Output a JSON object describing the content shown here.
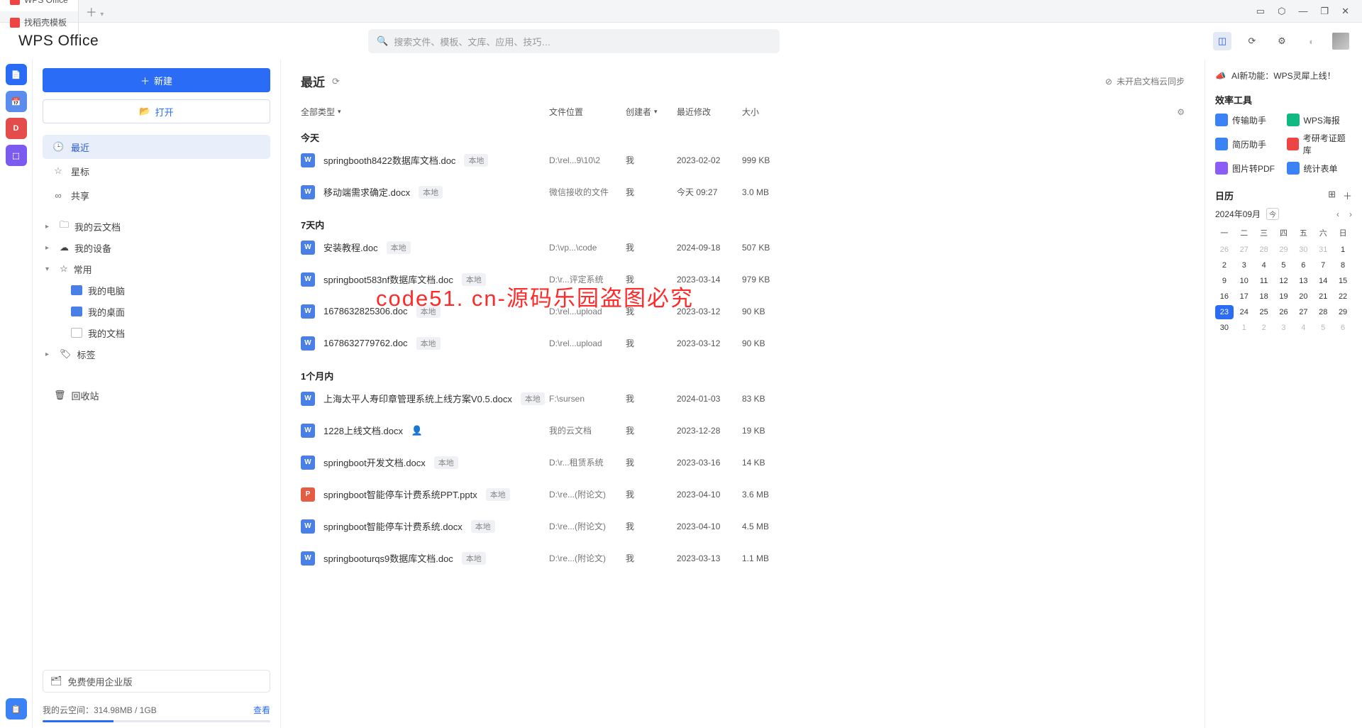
{
  "tabs": [
    {
      "label": "WPS Office",
      "active": true
    },
    {
      "label": "找稻壳模板",
      "active": false
    }
  ],
  "logo": "WPS Office",
  "search": {
    "placeholder": "搜索文件、模板、文库、应用、技巧…"
  },
  "buttons": {
    "new_label": "新建",
    "open_label": "打开"
  },
  "nav": {
    "recent": "最近",
    "star": "星标",
    "share": "共享"
  },
  "tree": {
    "cloud_docs": "我的云文档",
    "my_devices": "我的设备",
    "frequent": "常用",
    "my_computer": "我的电脑",
    "my_desktop": "我的桌面",
    "my_docs": "我的文档",
    "tag": "标签",
    "trash": "回收站"
  },
  "sidebar_footer": {
    "enterprise": "免费使用企业版",
    "quota_label": "我的云空间：",
    "quota_value": "314.98MB / 1GB",
    "view": "查看"
  },
  "content": {
    "title": "最近",
    "sync_note": "未开启文档云同步",
    "filter": "全部类型",
    "cols": {
      "name": "全部类型",
      "location": "文件位置",
      "creator": "创建者",
      "modified": "最近修改",
      "size": "大小"
    },
    "local_tag": "本地",
    "groups": [
      {
        "title": "今天",
        "files": [
          {
            "ico": "w",
            "name": "springbooth8422数据库文档.doc",
            "tag": true,
            "loc": "D:\\rel...9\\10\\2",
            "creator": "我",
            "mod": "2023-02-02",
            "size": "999 KB"
          },
          {
            "ico": "w",
            "name": "移动端需求确定.docx",
            "tag": true,
            "loc": "微信接收的文件",
            "creator": "我",
            "mod": "今天 09:27",
            "size": "3.0 MB"
          }
        ]
      },
      {
        "title": "7天内",
        "files": [
          {
            "ico": "w",
            "name": "安装教程.doc",
            "tag": true,
            "loc": "D:\\vp...\\code",
            "creator": "我",
            "mod": "2024-09-18",
            "size": "507 KB"
          },
          {
            "ico": "w",
            "name": "springboot583nf数据库文档.doc",
            "tag": true,
            "loc": "D:\\r...评定系统",
            "creator": "我",
            "mod": "2023-03-14",
            "size": "979 KB"
          },
          {
            "ico": "w",
            "name": "1678632825306.doc",
            "tag": true,
            "loc": "D:\\rel...upload",
            "creator": "我",
            "mod": "2023-03-12",
            "size": "90 KB"
          },
          {
            "ico": "w",
            "name": "1678632779762.doc",
            "tag": true,
            "loc": "D:\\rel...upload",
            "creator": "我",
            "mod": "2023-03-12",
            "size": "90 KB"
          }
        ]
      },
      {
        "title": "1个月内",
        "files": [
          {
            "ico": "w",
            "name": "上海太平人寿印章管理系统上线方案V0.5.docx",
            "tag": true,
            "loc": "F:\\sursen",
            "creator": "我",
            "mod": "2024-01-03",
            "size": "83 KB"
          },
          {
            "ico": "w",
            "name": "1228上线文档.docx",
            "tag": false,
            "cloud": true,
            "loc": "我的云文档",
            "creator": "我",
            "mod": "2023-12-28",
            "size": "19 KB"
          },
          {
            "ico": "w",
            "name": "springboot开发文档.docx",
            "tag": true,
            "loc": "D:\\r...租赁系统",
            "creator": "我",
            "mod": "2023-03-16",
            "size": "14 KB"
          },
          {
            "ico": "p",
            "name": "springboot智能停车计费系统PPT.pptx",
            "tag": true,
            "loc": "D:\\re...(附论文)",
            "creator": "我",
            "mod": "2023-04-10",
            "size": "3.6 MB"
          },
          {
            "ico": "w",
            "name": "springboot智能停车计费系统.docx",
            "tag": true,
            "loc": "D:\\re...(附论文)",
            "creator": "我",
            "mod": "2023-04-10",
            "size": "4.5 MB"
          },
          {
            "ico": "w",
            "name": "springbooturqs9数据库文档.doc",
            "tag": true,
            "loc": "D:\\re...(附论文)",
            "creator": "我",
            "mod": "2023-03-13",
            "size": "1.1 MB"
          }
        ]
      }
    ]
  },
  "rightp": {
    "ai_banner": "AI新功能：WPS灵犀上线！",
    "tools_title": "效率工具",
    "tools": [
      {
        "label": "传输助手",
        "c": "#3b82f6"
      },
      {
        "label": "WPS海报",
        "c": "#10b981"
      },
      {
        "label": "简历助手",
        "c": "#3b82f6"
      },
      {
        "label": "考研考证题库",
        "c": "#ef4444"
      },
      {
        "label": "图片转PDF",
        "c": "#8b5cf6"
      },
      {
        "label": "统计表单",
        "c": "#3b82f6"
      }
    ],
    "calendar": {
      "title": "日历",
      "month": "2024年09月",
      "today": "今",
      "dow": [
        "一",
        "二",
        "三",
        "四",
        "五",
        "六",
        "日"
      ],
      "prev": [
        26,
        27,
        28,
        29,
        30,
        31
      ],
      "days": [
        1,
        2,
        3,
        4,
        5,
        6,
        7,
        8,
        9,
        10,
        11,
        12,
        13,
        14,
        15,
        16,
        17,
        18,
        19,
        20,
        21,
        22,
        23,
        24,
        25,
        26,
        27,
        28,
        29,
        30
      ],
      "next": [
        1,
        2,
        3,
        4,
        5,
        6
      ],
      "selected": 23
    }
  },
  "watermark": "code51. cn-源码乐园盗图必究"
}
